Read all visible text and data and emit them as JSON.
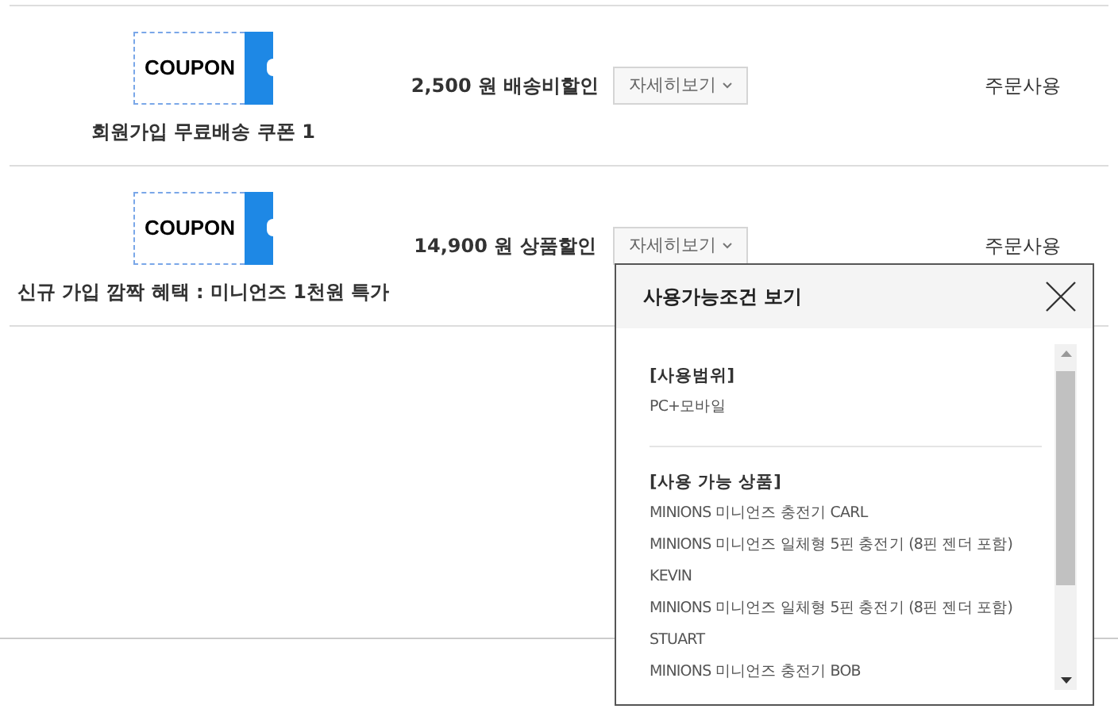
{
  "coupons": [
    {
      "badge": "COUPON",
      "name": "회원가입 무료배송 쿠폰 1",
      "amount": "2,500 원 배송비할인",
      "detail_button": "자세히보기",
      "usage": "주문사용"
    },
    {
      "badge": "COUPON",
      "name": "신규 가입 깜짝 혜택 : 미니언즈 1천원 특가",
      "amount": "14,900 원 상품할인",
      "detail_button": "자세히보기",
      "usage": "주문사용"
    }
  ],
  "popup": {
    "title": "사용가능조건 보기",
    "sections": [
      {
        "heading": "[사용범위]",
        "lines": [
          "PC+모바일"
        ]
      },
      {
        "heading": "[사용 가능 상품]",
        "lines": [
          "MINIONS 미니언즈 충전기 CARL",
          "MINIONS 미니언즈 일체형 5핀 충전기 (8핀 젠더 포함)",
          "KEVIN",
          "MINIONS 미니언즈 일체형 5핀 충전기 (8핀 젠더 포함)",
          "STUART",
          "MINIONS 미니언즈 충전기 BOB"
        ]
      }
    ]
  }
}
